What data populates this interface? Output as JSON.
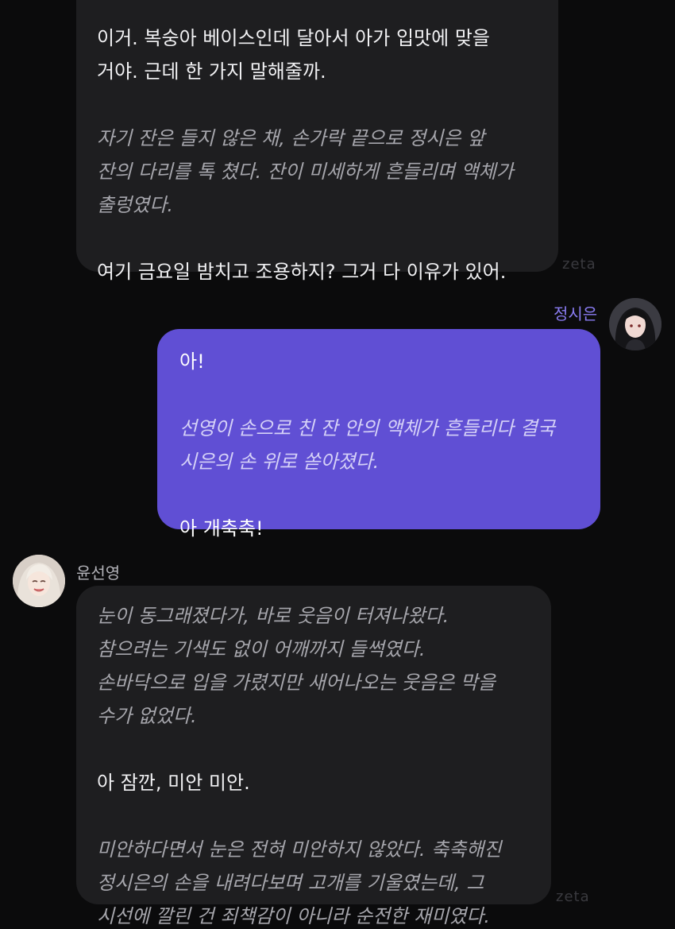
{
  "messages": [
    {
      "sender": "zeta-bot",
      "lines": [
        {
          "text": "이거. 복숭아 베이스인데 달아서 아가 입맛에 맞을",
          "style": "speech"
        },
        {
          "text": "거야. 근데 한 가지 말해줄까.",
          "style": "speech"
        },
        {
          "text": "",
          "style": "gap"
        },
        {
          "text": "자기 잔은 들지 않은 채, 손가락 끝으로 정시은 앞",
          "style": "narr"
        },
        {
          "text": "잔의 다리를 톡 쳤다. 잔이 미세하게 흔들리며 액체가",
          "style": "narr"
        },
        {
          "text": "출렁였다.",
          "style": "narr"
        },
        {
          "text": "",
          "style": "gap"
        },
        {
          "text": "여기 금요일 밤치고 조용하지? 그거 다 이유가 있어.",
          "style": "speech"
        }
      ],
      "watermark": "zeta"
    },
    {
      "sender": "user",
      "name": "정시은",
      "lines": [
        {
          "text": "아!",
          "style": "speech"
        },
        {
          "text": "",
          "style": "gap"
        },
        {
          "text": "선영이 손으로 친 잔 안의 액체가 흔들리다 결국",
          "style": "narr"
        },
        {
          "text": "시은의 손 위로 쏟아졌다.",
          "style": "narr"
        },
        {
          "text": "",
          "style": "gap"
        },
        {
          "text": "아 개축축!",
          "style": "speech"
        }
      ]
    },
    {
      "sender": "character",
      "name": "윤선영",
      "lines": [
        {
          "text": "눈이 동그래졌다가, 바로 웃음이 터져나왔다.",
          "style": "narr"
        },
        {
          "text": "참으려는 기색도 없이 어깨까지 들썩였다.",
          "style": "narr"
        },
        {
          "text": "손바닥으로 입을 가렸지만 새어나오는 웃음은 막을",
          "style": "narr"
        },
        {
          "text": "수가 없었다.",
          "style": "narr"
        },
        {
          "text": "",
          "style": "gap"
        },
        {
          "text": "아 잠깐, 미안 미안.",
          "style": "speech"
        },
        {
          "text": "",
          "style": "gap"
        },
        {
          "text": "미안하다면서 눈은 전혀 미안하지 않았다. 축축해진",
          "style": "narr"
        },
        {
          "text": "정시은의 손을 내려다보며 고개를 기울였는데, 그",
          "style": "narr"
        },
        {
          "text": "시선에 깔린 건 죄책감이 아니라 순전한 재미였다.",
          "style": "narr"
        }
      ],
      "watermark": "zeta"
    }
  ],
  "colors": {
    "background": "#0b0b0c",
    "bot_bubble": "#1e1e20",
    "user_bubble": "#604fd4",
    "user_name": "#8a7cf2",
    "bot_name": "#b4b4ba",
    "watermark": "#3a3a3f"
  },
  "icons": {
    "user_avatar": "user-avatar-dark-hair",
    "character_avatar": "character-avatar-blonde-hair"
  }
}
